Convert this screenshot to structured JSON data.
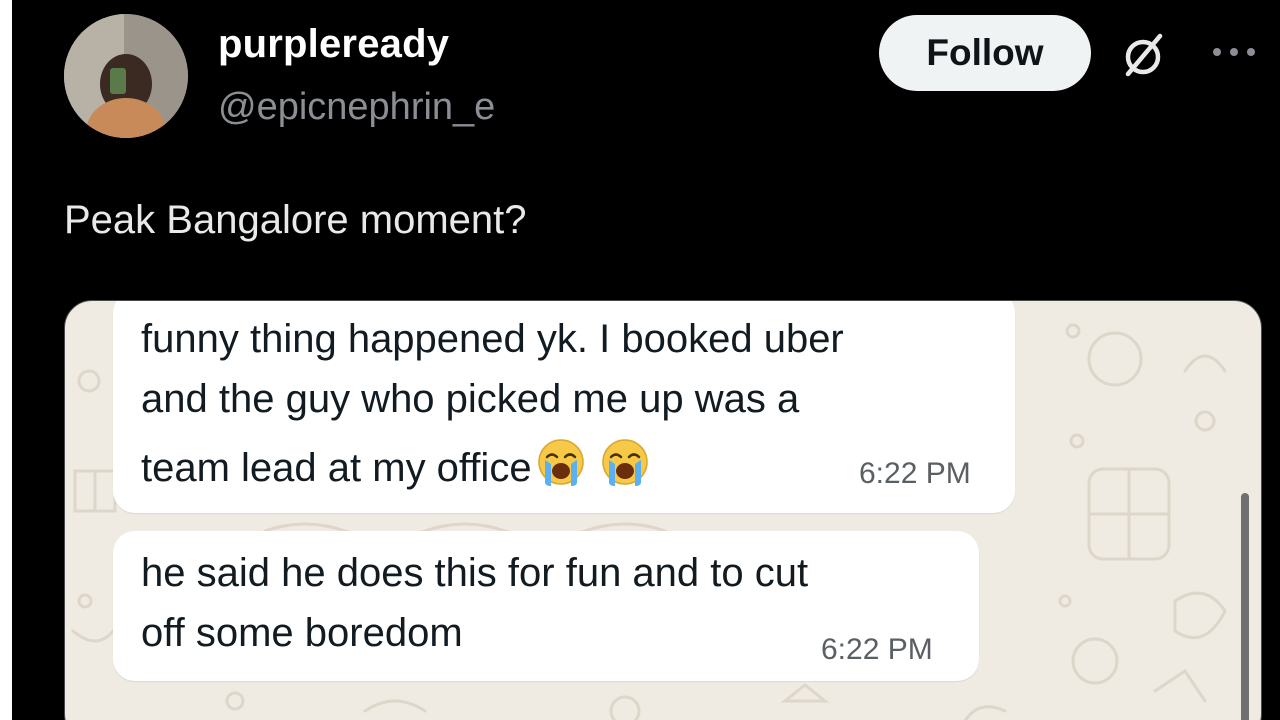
{
  "tweet": {
    "display_name": "purpleready",
    "handle": "@epicnephrin_e",
    "follow_label": "Follow",
    "text": "Peak Bangalore moment?"
  },
  "icons": {
    "grok": "grok-icon",
    "more": "more-icon",
    "crying_face": "loudly-crying-face-emoji"
  },
  "chat": {
    "messages": [
      {
        "lines": [
          "funny thing happened yk. I booked uber",
          "and the guy who picked me up was a",
          "team lead at my office"
        ],
        "time": "6:22 PM"
      },
      {
        "lines": [
          "he said he does this for fun and to cut",
          "off some boredom"
        ],
        "time": "6:22 PM"
      }
    ]
  },
  "colors": {
    "background": "#000000",
    "follow_button": "#eff3f4",
    "chat_wallpaper": "#efeae2",
    "bubble": "#ffffff",
    "handle_gray": "#8b8f95"
  }
}
